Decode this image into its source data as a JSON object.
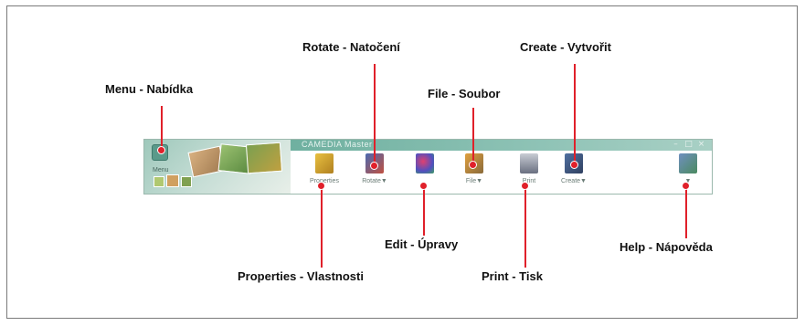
{
  "callouts": {
    "menu": "Menu - Nabídka",
    "rotate": "Rotate - Natočení",
    "create": "Create - Vytvořit",
    "file": "File - Soubor",
    "edit": "Edit - Úpravy",
    "help": "Help - Nápověda",
    "properties": "Properties - Vlastnosti",
    "print": "Print - Tisk"
  },
  "toolbar": {
    "title": "CAMEDIA Master",
    "menu_caption": "Menu",
    "buttons": [
      {
        "id": "properties",
        "caption": "Properties",
        "icon": "properties-icon"
      },
      {
        "id": "rotate",
        "caption": "Rotate▼",
        "icon": "rotate-icon"
      },
      {
        "id": "edit",
        "caption": "",
        "icon": "edit-icon"
      },
      {
        "id": "file",
        "caption": "File▼",
        "icon": "file-icon"
      },
      {
        "id": "print",
        "caption": "Print",
        "icon": "print-icon"
      },
      {
        "id": "create",
        "caption": "Create▼",
        "icon": "create-icon"
      },
      {
        "id": "help",
        "caption": "▼",
        "icon": "help-icon"
      }
    ]
  },
  "colors": {
    "pointer": "#e0202a",
    "toolbar_accent": "#6fb0a0"
  }
}
